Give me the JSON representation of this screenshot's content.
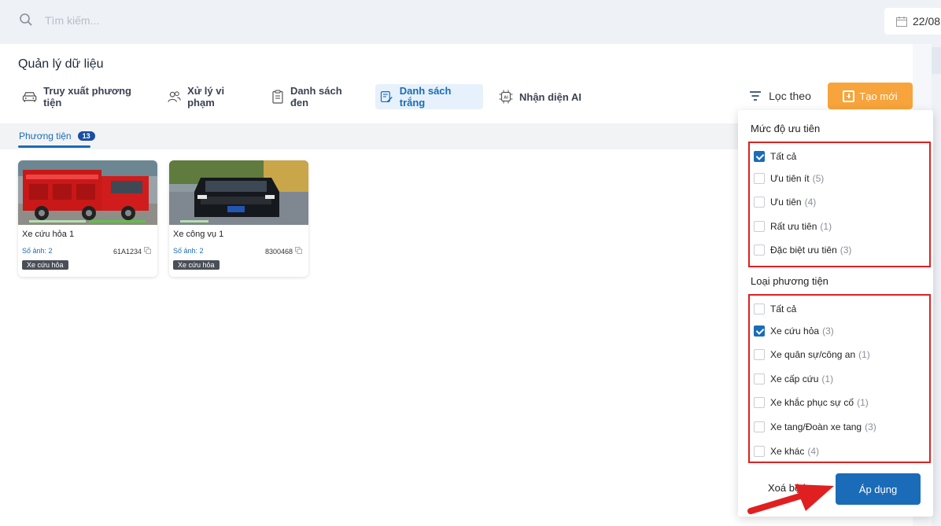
{
  "search": {
    "placeholder": "Tìm kiếm..."
  },
  "date": {
    "text": "22/08"
  },
  "page_title": "Quản lý dữ liệu",
  "tabs": [
    {
      "label": "Truy xuất phương tiện",
      "icon": "car-icon",
      "active": false
    },
    {
      "label": "Xử lý vi phạm",
      "icon": "users-icon",
      "active": false
    },
    {
      "label": "Danh sách đen",
      "icon": "clipboard-icon",
      "active": false
    },
    {
      "label": "Danh sách trắng",
      "icon": "list-edit-icon",
      "active": true
    },
    {
      "label": "Nhận diện AI",
      "icon": "ai-chip-icon",
      "active": false
    }
  ],
  "subtab": {
    "label": "Phương tiện",
    "count": "13"
  },
  "actions": {
    "filter_label": "Lọc theo",
    "new_label": "Tạo mới"
  },
  "cards": [
    {
      "name": "Xe cứu hỏa 1",
      "photos": "Số ảnh: 2",
      "plate": "61A1234",
      "tag": "Xe cứu hỏa"
    },
    {
      "name": "Xe công vụ 1",
      "photos": "Số ảnh: 2",
      "plate": "8300468",
      "tag": "Xe cứu hỏa"
    }
  ],
  "filter": {
    "priority": {
      "title": "Mức độ ưu tiên",
      "options": [
        {
          "label": "Tất cả",
          "count": "",
          "checked": true
        },
        {
          "label": "Ưu tiên ít",
          "count": "(5)",
          "checked": false
        },
        {
          "label": "Ưu tiên",
          "count": "(4)",
          "checked": false
        },
        {
          "label": "Rất ưu tiên",
          "count": "(1)",
          "checked": false
        },
        {
          "label": "Đặc biệt ưu tiên",
          "count": "(3)",
          "checked": false
        }
      ]
    },
    "vehicle_type": {
      "title": "Loại phương tiện",
      "options": [
        {
          "label": "Tất cả",
          "count": "",
          "checked": false
        },
        {
          "label": "Xe cứu hỏa",
          "count": "(3)",
          "checked": true
        },
        {
          "label": "Xe quân sự/công an",
          "count": "(1)",
          "checked": false
        },
        {
          "label": "Xe cấp cứu",
          "count": "(1)",
          "checked": false
        },
        {
          "label": "Xe khắc phục sự cố",
          "count": "(1)",
          "checked": false
        },
        {
          "label": "Xe tang/Đoàn xe tang",
          "count": "(3)",
          "checked": false
        },
        {
          "label": "Xe khác",
          "count": "(4)",
          "checked": false
        }
      ]
    },
    "clear_label": "Xoá bộ lọc",
    "apply_label": "Áp dụng"
  },
  "colors": {
    "primary": "#1a6cb8",
    "accent": "#f6a43b",
    "highlight": "#e02020"
  }
}
